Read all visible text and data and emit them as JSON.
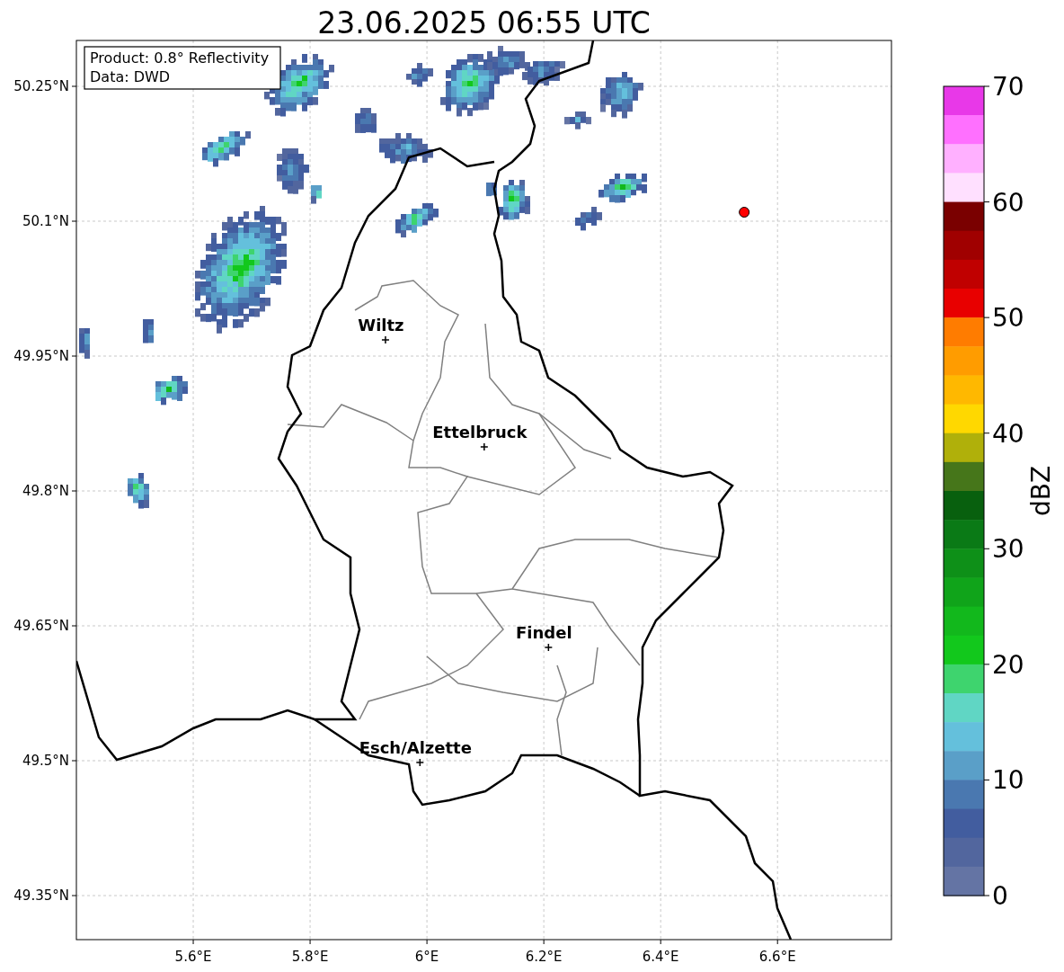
{
  "title": "23.06.2025 06:55 UTC",
  "info_box": [
    "Product: 0.8° Reflectivity",
    "Data: DWD"
  ],
  "map": {
    "xticks": [
      "5.6°E",
      "5.8°E",
      "6°E",
      "6.2°E",
      "6.4°E",
      "6.6°E"
    ],
    "yticks": [
      "50.25°N",
      "50.1°N",
      "49.95°N",
      "49.8°N",
      "49.65°N",
      "49.5°N",
      "49.35°N"
    ],
    "cities": [
      {
        "name": "Wiltz"
      },
      {
        "name": "Ettelbruck"
      },
      {
        "name": "Findel"
      },
      {
        "name": "Esch/Alzette"
      }
    ]
  },
  "colorbar": {
    "label": "dBZ",
    "ticks": [
      "70",
      "60",
      "50",
      "40",
      "30",
      "20",
      "10",
      "0"
    ],
    "bins": [
      {
        "color": "#e838e8"
      },
      {
        "color": "#ff70ff"
      },
      {
        "color": "#ffb0ff"
      },
      {
        "color": "#ffe0ff"
      },
      {
        "color": "#7a0000"
      },
      {
        "color": "#a00000"
      },
      {
        "color": "#c00000"
      },
      {
        "color": "#e80000"
      },
      {
        "color": "#ff7c00"
      },
      {
        "color": "#ff9c00"
      },
      {
        "color": "#ffb800"
      },
      {
        "color": "#ffd800"
      },
      {
        "color": "#b0b00a"
      },
      {
        "color": "#46761a"
      },
      {
        "color": "#08600e"
      },
      {
        "color": "#0a7a16"
      },
      {
        "color": "#0e9018"
      },
      {
        "color": "#10a41a"
      },
      {
        "color": "#12b81c"
      },
      {
        "color": "#12c81c"
      },
      {
        "color": "#3ed46e"
      },
      {
        "color": "#60d6c4"
      },
      {
        "color": "#64c0dc"
      },
      {
        "color": "#5a9fc8"
      },
      {
        "color": "#4a78b0"
      },
      {
        "color": "#425d9f"
      },
      {
        "color": "#52669e"
      },
      {
        "color": "#6474a4"
      }
    ]
  }
}
